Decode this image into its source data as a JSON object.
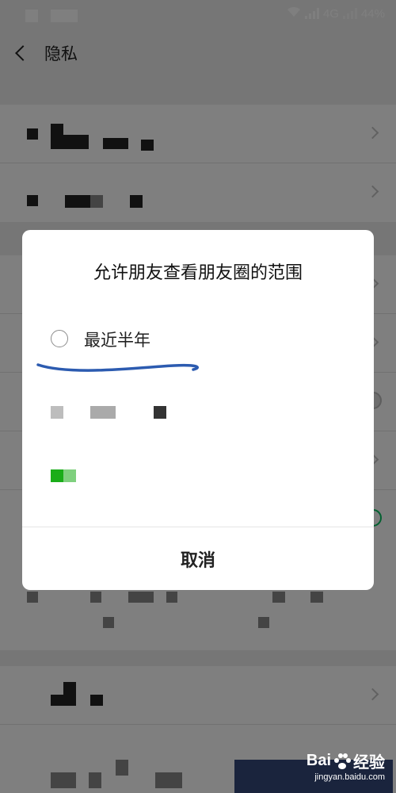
{
  "status_bar": {
    "network": "4G",
    "battery": "44%"
  },
  "nav": {
    "title": "隐私"
  },
  "dialog": {
    "title": "允许朋友查看朋友圈的范围",
    "options": [
      {
        "label": "最近半年",
        "selected": false
      }
    ],
    "cancel_label": "取消"
  },
  "colors": {
    "accent_green": "#07c160",
    "underline_blue": "#2c5bb0"
  },
  "icons": {
    "back": "chevron-left-icon",
    "row_arrow": "chevron-right-icon",
    "radio": "radio-icon"
  }
}
